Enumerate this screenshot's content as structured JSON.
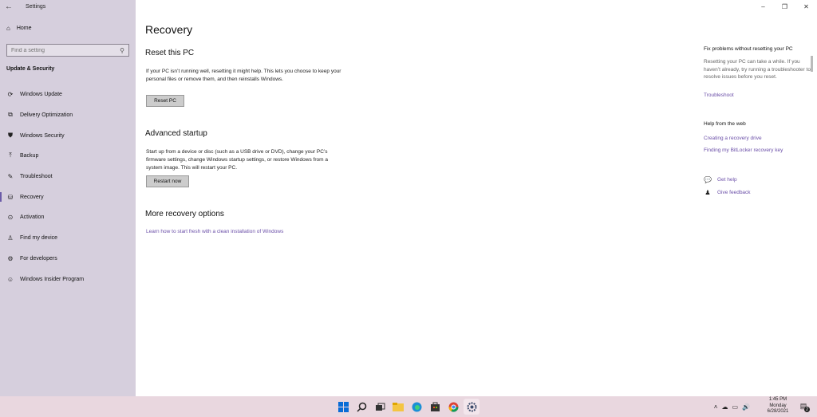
{
  "window": {
    "app_title": "Settings",
    "back_icon": "arrow-left-icon",
    "controls": {
      "minimize": "–",
      "restore": "❐",
      "close": "✕"
    }
  },
  "sidebar": {
    "home_label": "Home",
    "search_placeholder": "Find a setting",
    "section_label": "Update & Security",
    "items": [
      {
        "label": "Windows Update",
        "icon": "refresh-icon",
        "glyph": "⟳"
      },
      {
        "label": "Delivery Optimization",
        "icon": "delivery-optimization-icon",
        "glyph": "⧉"
      },
      {
        "label": "Windows Security",
        "icon": "shield-icon",
        "glyph": "⛊"
      },
      {
        "label": "Backup",
        "icon": "backup-icon",
        "glyph": "⤒"
      },
      {
        "label": "Troubleshoot",
        "icon": "wrench-icon",
        "glyph": "🔧"
      },
      {
        "label": "Recovery",
        "icon": "recovery-icon",
        "glyph": "⛁"
      },
      {
        "label": "Activation",
        "icon": "check-circle-icon",
        "glyph": "⊘"
      },
      {
        "label": "Find my device",
        "icon": "person-location-icon",
        "glyph": "⚲"
      },
      {
        "label": "For developers",
        "icon": "developer-icon",
        "glyph": "⚙"
      },
      {
        "label": "Windows Insider Program",
        "icon": "insider-icon",
        "glyph": "☺"
      }
    ],
    "active_item": "Recovery"
  },
  "main": {
    "page_title": "Recovery",
    "reset": {
      "heading": "Reset this PC",
      "text": "If your PC isn’t running well, resetting it might help. This lets you choose to keep your personal files or remove them, and then reinstalls Windows.",
      "button": "Reset PC"
    },
    "advanced": {
      "heading": "Advanced startup",
      "text": "Start up from a device or disc (such as a USB drive or DVD), change your PC’s firmware settings, change Windows startup settings, or restore Windows from a system image. This will restart your PC.",
      "button": "Restart now"
    },
    "more": {
      "heading": "More recovery options",
      "link": "Learn how to start fresh with a clean installation of Windows"
    }
  },
  "right_panel": {
    "fix_heading": "Fix problems without resetting your PC",
    "fix_text": "Resetting your PC can take a while. If you haven’t already, try running a troubleshooter to resolve issues before you reset.",
    "fix_link": "Troubleshoot",
    "web_heading": "Help from the web",
    "web_links": [
      "Creating a recovery drive",
      "Finding my BitLocker recovery key"
    ],
    "get_help": "Get help",
    "give_feedback": "Give feedback"
  },
  "taskbar": {
    "apps": [
      "windows-start-icon",
      "search-icon",
      "task-view-icon",
      "file-explorer-icon",
      "edge-browser-icon",
      "store-icon",
      "chrome-icon",
      "settings-icon"
    ],
    "time": "1:45 PM",
    "day": "Monday",
    "date": "6/28/2021",
    "notification_count": "2"
  }
}
